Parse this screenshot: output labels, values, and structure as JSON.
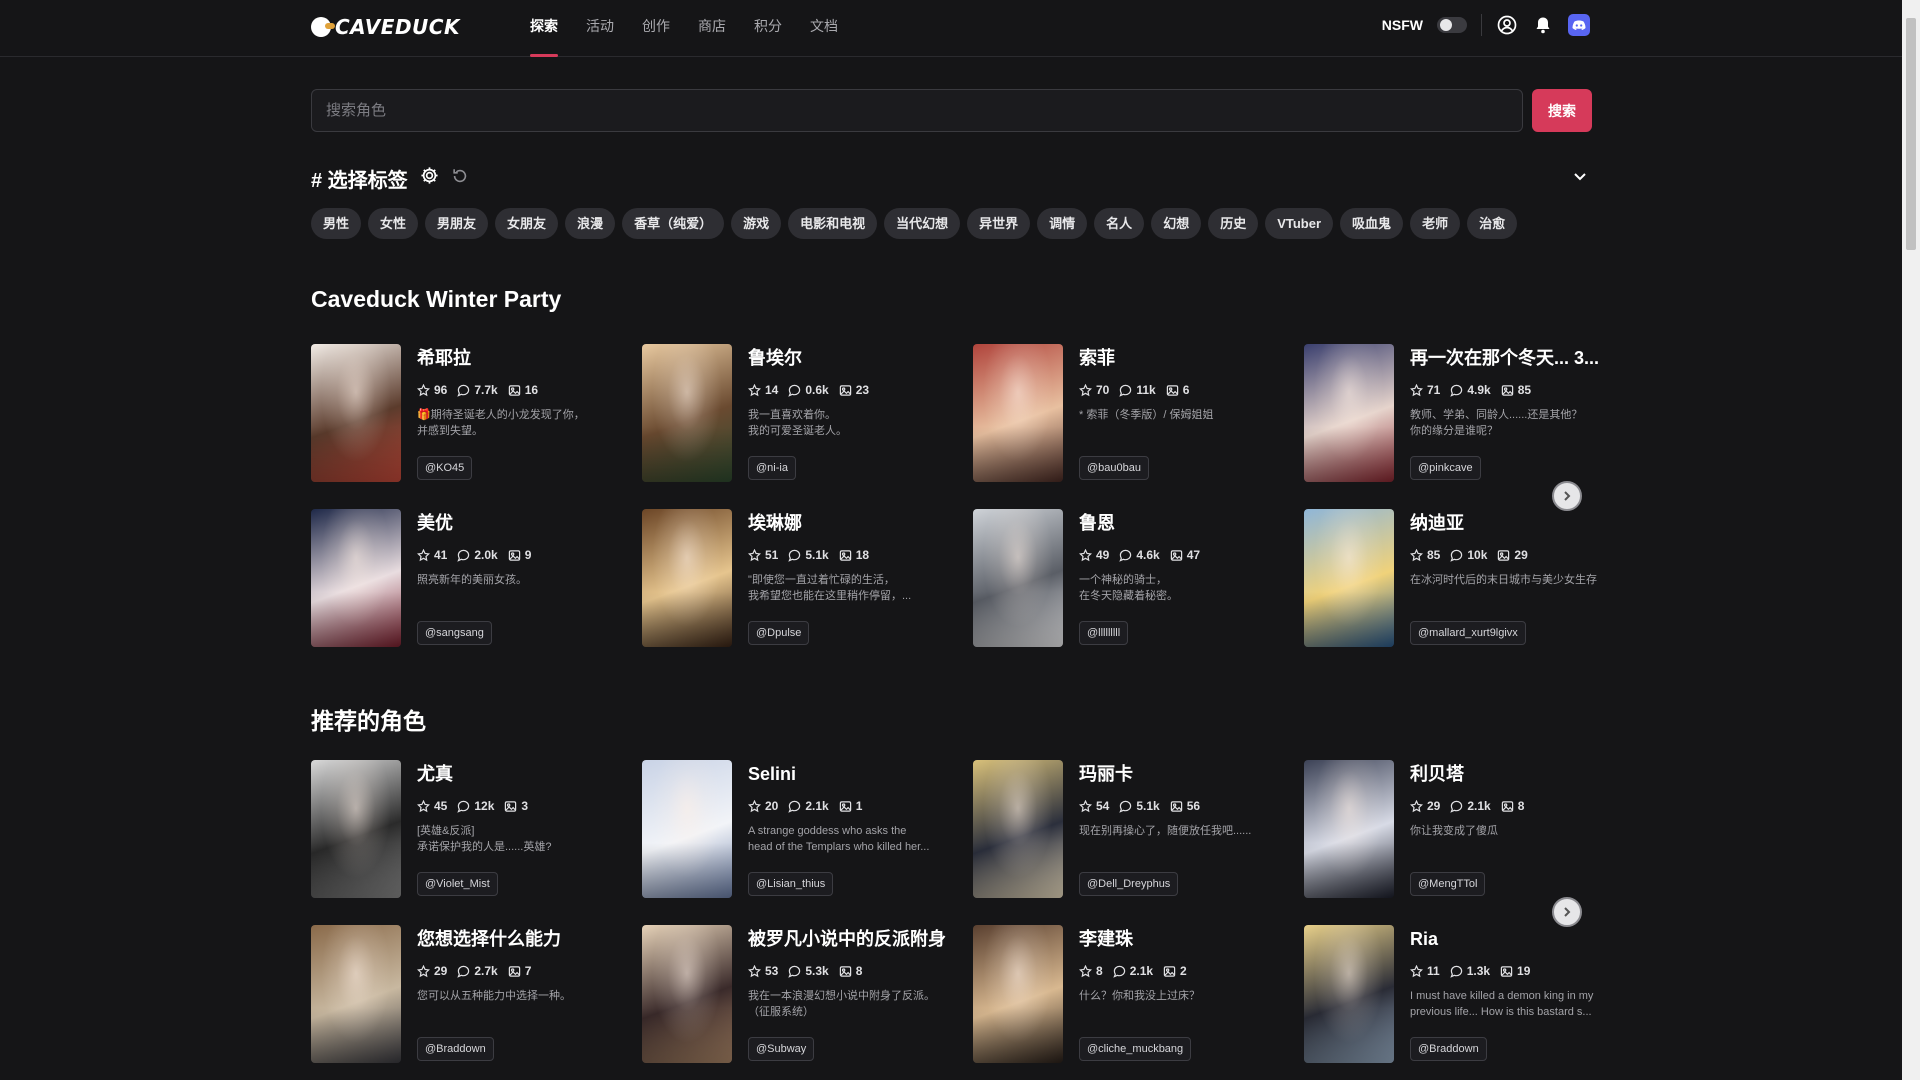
{
  "header": {
    "logo_text": "CAVEDUCK",
    "nav": [
      {
        "label": "探索",
        "active": true
      },
      {
        "label": "活动",
        "active": false
      },
      {
        "label": "创作",
        "active": false
      },
      {
        "label": "商店",
        "active": false
      },
      {
        "label": "积分",
        "active": false
      },
      {
        "label": "文档",
        "active": false
      }
    ],
    "nsfw_label": "NSFW",
    "icons": [
      "user-circle-icon",
      "bell-icon",
      "discord-icon"
    ]
  },
  "search": {
    "placeholder": "搜索角色",
    "button_label": "搜索"
  },
  "tags": {
    "title": "# 选择标签",
    "items": [
      "男性",
      "女性",
      "男朋友",
      "女朋友",
      "浪漫",
      "香草（纯爱）",
      "游戏",
      "电影和电视",
      "当代幻想",
      "异世界",
      "调情",
      "名人",
      "幻想",
      "历史",
      "VTuber",
      "吸血鬼",
      "老师",
      "治愈"
    ]
  },
  "sections": [
    {
      "title": "Caveduck Winter Party",
      "cards": [
        {
          "name": "希耶拉",
          "stars": "96",
          "chats": "7.7k",
          "images": "16",
          "desc": "🎁期待圣诞老人的小龙发现了你，\n并感到失望。",
          "author": "@KO45",
          "palette": [
            "#f2ece6",
            "#5b3b2c",
            "#c84a3a"
          ]
        },
        {
          "name": "鲁埃尔",
          "stars": "14",
          "chats": "0.6k",
          "images": "23",
          "desc": "我一直喜欢着你。\n我的可爱圣诞老人。",
          "author": "@ni-ia",
          "palette": [
            "#e8c9a0",
            "#6a4a30",
            "#2e4b2f"
          ]
        },
        {
          "name": "索菲",
          "stars": "70",
          "chats": "11k",
          "images": "6",
          "desc": "* 索菲（冬季版）/ 保姆姐姐",
          "author": "@bau0bau",
          "palette": [
            "#b0443c",
            "#e8c0a0",
            "#4a2a24"
          ]
        },
        {
          "name": "再一次在那个冬天... 3...",
          "stars": "71",
          "chats": "4.9k",
          "images": "85",
          "desc": "教师、学弟、同龄人......还是其他？\n你的缘分是谁呢？",
          "author": "@pinkcave",
          "palette": [
            "#3a3f6e",
            "#e6d4cc",
            "#8a2630"
          ]
        },
        {
          "name": "美优",
          "stars": "41",
          "chats": "2.0k",
          "images": "9",
          "desc": "照亮新年的美丽女孩。",
          "author": "@sangsang",
          "palette": [
            "#1e2848",
            "#e9dde0",
            "#7c1f2e"
          ]
        },
        {
          "name": "埃琳娜",
          "stars": "51",
          "chats": "5.1k",
          "images": "18",
          "desc": "\"即使您一直过着忙碌的生活，\n我希望您也能在这里稍作停留，...",
          "author": "@Dpulse",
          "palette": [
            "#6b4526",
            "#e6c58e",
            "#3a2416"
          ]
        },
        {
          "name": "鲁恩",
          "stars": "49",
          "chats": "4.6k",
          "images": "47",
          "desc": "一个神秘的骑士，\n在冬天隐藏着秘密。",
          "author": "@lllllllll",
          "palette": [
            "#cfd3d8",
            "#5a5e66",
            "#f2f2f4"
          ]
        },
        {
          "name": "纳迪亚",
          "stars": "85",
          "chats": "10k",
          "images": "29",
          "desc": "在冰河时代后的末日城市与美少女生存",
          "author": "@mallard_xurt9lgivx",
          "palette": [
            "#8fb6d8",
            "#f0d27a",
            "#2a5a8c"
          ]
        }
      ]
    },
    {
      "title": "推荐的角色",
      "cards": [
        {
          "name": "尤真",
          "stars": "45",
          "chats": "12k",
          "images": "3",
          "desc": "[英雄&反派]\n承诺保护我的人是......英雄?",
          "author": "@Violet_Mist",
          "palette": [
            "#d9d9d9",
            "#2a2a2a",
            "#8c8c8c"
          ]
        },
        {
          "name": "Selini",
          "stars": "20",
          "chats": "2.1k",
          "images": "1",
          "desc": "A strange goddess who asks the\nhead of the Templars who killed her...",
          "author": "@Lisian_thius",
          "palette": [
            "#c9d3e6",
            "#f2f4f8",
            "#6c7fa8"
          ]
        },
        {
          "name": "玛丽卡",
          "stars": "54",
          "chats": "5.1k",
          "images": "56",
          "desc": "现在别再操心了，随便放任我吧......",
          "author": "@Dell_Dreyphus",
          "palette": [
            "#d8c07a",
            "#2b2f3c",
            "#f0e2c4"
          ]
        },
        {
          "name": "利贝塔",
          "stars": "29",
          "chats": "2.1k",
          "images": "8",
          "desc": "你让我变成了傻瓜",
          "author": "@MengTTol",
          "palette": [
            "#3c4256",
            "#d8dbe6",
            "#1c1f2c"
          ]
        },
        {
          "name": "您想选择什么能力",
          "stars": "29",
          "chats": "2.7k",
          "images": "7",
          "desc": "您可以从五种能力中选择一种。",
          "author": "@Braddown",
          "palette": [
            "#8a6a4a",
            "#c8b8a0",
            "#3a3a40"
          ]
        },
        {
          "name": "被罗凡小说中的反派附身",
          "stars": "53",
          "chats": "5.3k",
          "images": "8",
          "desc": "我在一本浪漫幻想小说中附身了反派。\n（征服系统）",
          "author": "@Subway",
          "palette": [
            "#e6d2b8",
            "#3a2a2a",
            "#b08a6a"
          ]
        },
        {
          "name": "李建珠",
          "stars": "8",
          "chats": "2.1k",
          "images": "2",
          "desc": "什么？你和我没上过床？",
          "author": "@cliche_muckbang",
          "palette": [
            "#5a4030",
            "#d8b890",
            "#2a201a"
          ]
        },
        {
          "name": "Ria",
          "stars": "11",
          "chats": "1.3k",
          "images": "19",
          "desc": "I must have killed a demon king in my\nprevious life... How is this bastard s...",
          "author": "@Braddown",
          "palette": [
            "#e8d08a",
            "#2a2c36",
            "#9ab0c8"
          ]
        }
      ]
    }
  ]
}
